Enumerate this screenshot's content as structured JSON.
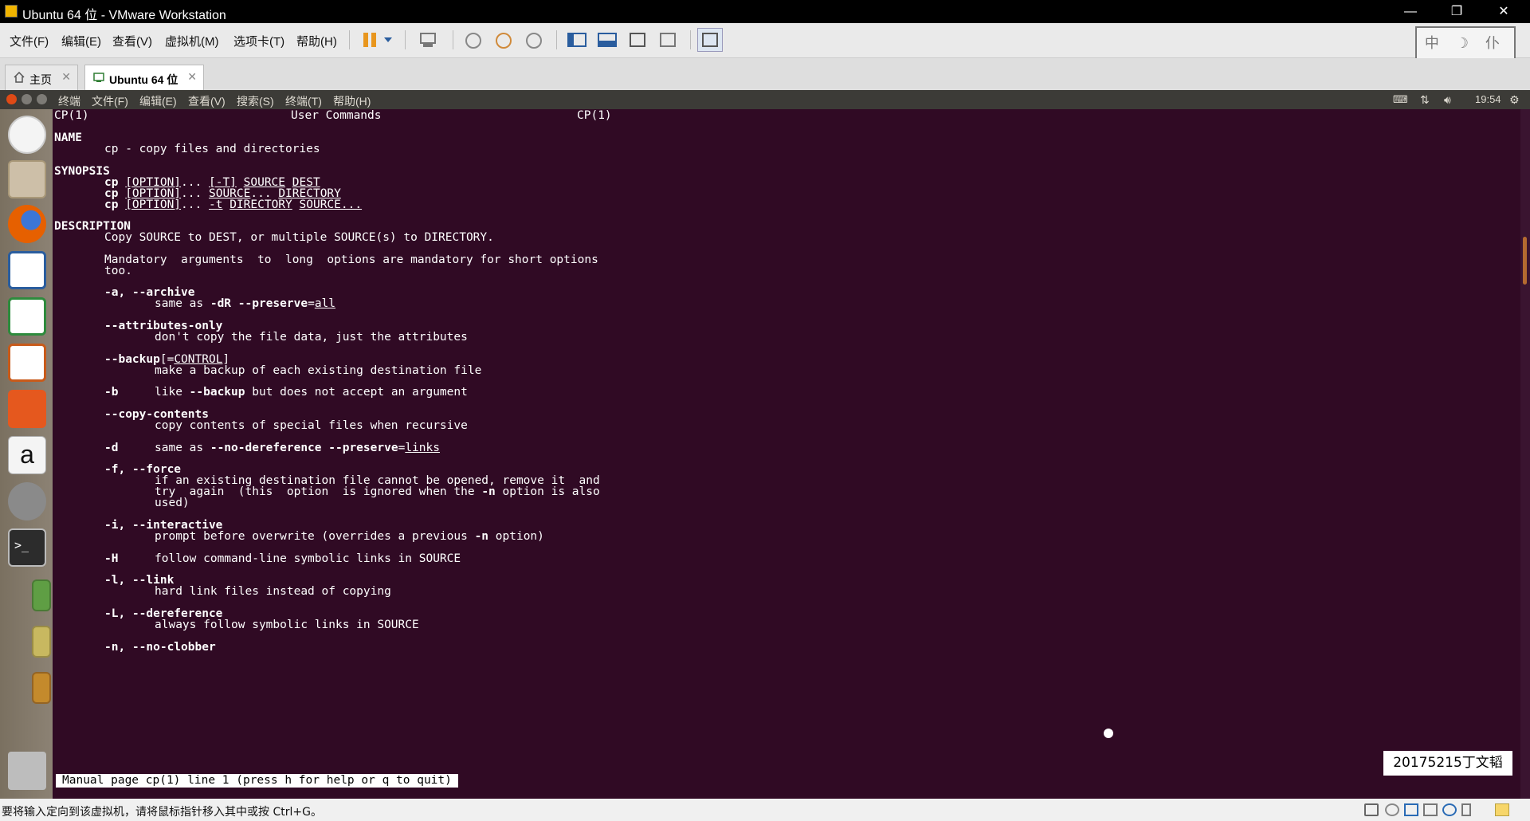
{
  "window": {
    "title": "Ubuntu 64 位 - VMware Workstation",
    "minimize_glyph": "—",
    "restore_glyph": "❐",
    "close_glyph": "✕"
  },
  "menubar": {
    "items": [
      "文件(F)",
      "编辑(E)",
      "查看(V)",
      "虚拟机(M)",
      "选项卡(T)",
      "帮助(H)"
    ]
  },
  "toolbar": {
    "icons": [
      "pause-icon",
      "dropdown-arrow-icon",
      "send-ctrl-alt-del-icon",
      "snapshot-take-icon",
      "snapshot-revert-icon",
      "snapshot-manager-icon",
      "library-view-icon",
      "console-view-icon",
      "fullscreen-icon",
      "unity-icon",
      "thumbnail-view-icon"
    ],
    "ime_badge": "中 ☽ 仆"
  },
  "tabs": [
    {
      "label": "主页",
      "icon": "home-icon",
      "active": false
    },
    {
      "label": "Ubuntu 64 位",
      "icon": "vm-icon",
      "active": true
    }
  ],
  "ubuntu_panel": {
    "menus": [
      "终端",
      "文件(F)",
      "编辑(E)",
      "查看(V)",
      "搜索(S)",
      "终端(T)",
      "帮助(H)"
    ],
    "time": "19:54",
    "indicators": [
      "keyboard-icon",
      "network-icon",
      "volume-icon",
      "settings-gear-icon"
    ]
  },
  "launcher": {
    "items": [
      "ubuntu-dash-icon",
      "files-icon",
      "firefox-icon",
      "writer-icon",
      "calc-icon",
      "impress-icon",
      "software-center-icon",
      "amazon-icon",
      "system-settings-icon",
      "terminal-icon",
      "workspace-green-icon",
      "workspace-yellow-icon",
      "workspace-orange-icon",
      "trash-icon"
    ]
  },
  "manpage": {
    "header_left": "CP(1)",
    "header_center": "User Commands",
    "header_right": "CP(1)",
    "name_heading": "NAME",
    "name_text": "cp - copy files and directories",
    "synopsis_heading": "SYNOPSIS",
    "synopsis": [
      {
        "cmd": "cp",
        "a": "[OPTION]",
        "b": "...",
        "c": "[-T]",
        "d": "SOURCE",
        "e": "DEST"
      },
      {
        "cmd": "cp",
        "a": "[OPTION]",
        "b": "...",
        "c": "SOURCE",
        "d": "...",
        "e": "DIRECTORY"
      },
      {
        "cmd": "cp",
        "a": "[OPTION]",
        "b": "...",
        "c": "-t",
        "d": "DIRECTORY",
        "e": "SOURCE..."
      }
    ],
    "description_heading": "DESCRIPTION",
    "desc_line1": "Copy SOURCE to DEST, or multiple SOURCE(s) to DIRECTORY.",
    "desc_line2a": "Mandatory  arguments  to  long  options are mandatory for short options",
    "desc_line2b": "too.",
    "options": {
      "a_flag": "-a, --archive",
      "a_desc_pre": "same as ",
      "a_desc_dR": "-dR",
      "a_desc_preserve": "--preserve",
      "a_desc_eq": "=",
      "a_desc_all": "all",
      "attr_flag": "--attributes-only",
      "attr_desc": "don't copy the file data, just the attributes",
      "backup_flag": "--backup",
      "backup_bracket_open": "[=",
      "backup_control": "CONTROL",
      "backup_bracket_close": "]",
      "backup_desc": "make a backup of each existing destination file",
      "b_flag": "-b",
      "b_desc_pre": "like ",
      "b_desc_backup": "--backup",
      "b_desc_post": " but does not accept an argument",
      "cc_flag": "--copy-contents",
      "cc_desc": "copy contents of special files when recursive",
      "d_flag": "-d",
      "d_desc_pre": "same as ",
      "d_desc_noderef": "--no-dereference",
      "d_desc_preserve": "--preserve",
      "d_desc_eq": "=",
      "d_desc_links": "links",
      "f_flag": "-f, --force",
      "f_desc1": "if an existing destination file cannot be opened, remove it  and",
      "f_desc2_pre": "try  again  (this  option  is ignored when the ",
      "f_desc2_n": "-n",
      "f_desc2_post": " option is also",
      "f_desc3": "used)",
      "i_flag": "-i, --interactive",
      "i_desc_pre": "prompt before overwrite (overrides a previous ",
      "i_desc_n": "-n",
      "i_desc_post": " option)",
      "H_flag": "-H",
      "H_desc": "follow command-line symbolic links in SOURCE",
      "l_flag": "-l, --link",
      "l_desc": "hard link files instead of copying",
      "L_flag": "-L, --dereference",
      "L_desc": "always follow symbolic links in SOURCE",
      "n_flag": "-n, --no-clobber"
    },
    "status_line": "Manual page cp(1) line 1 (press h for help or q to quit)"
  },
  "watermark": "20175215丁文韬",
  "statusbar": {
    "message": "要将输入定向到该虚拟机，请将鼠标指针移入其中或按 Ctrl+G。",
    "icons": [
      "hdd-icon",
      "cd-icon",
      "network-adapter-icon",
      "printer-icon",
      "sound-icon",
      "usb-icon",
      "message-icon"
    ]
  }
}
